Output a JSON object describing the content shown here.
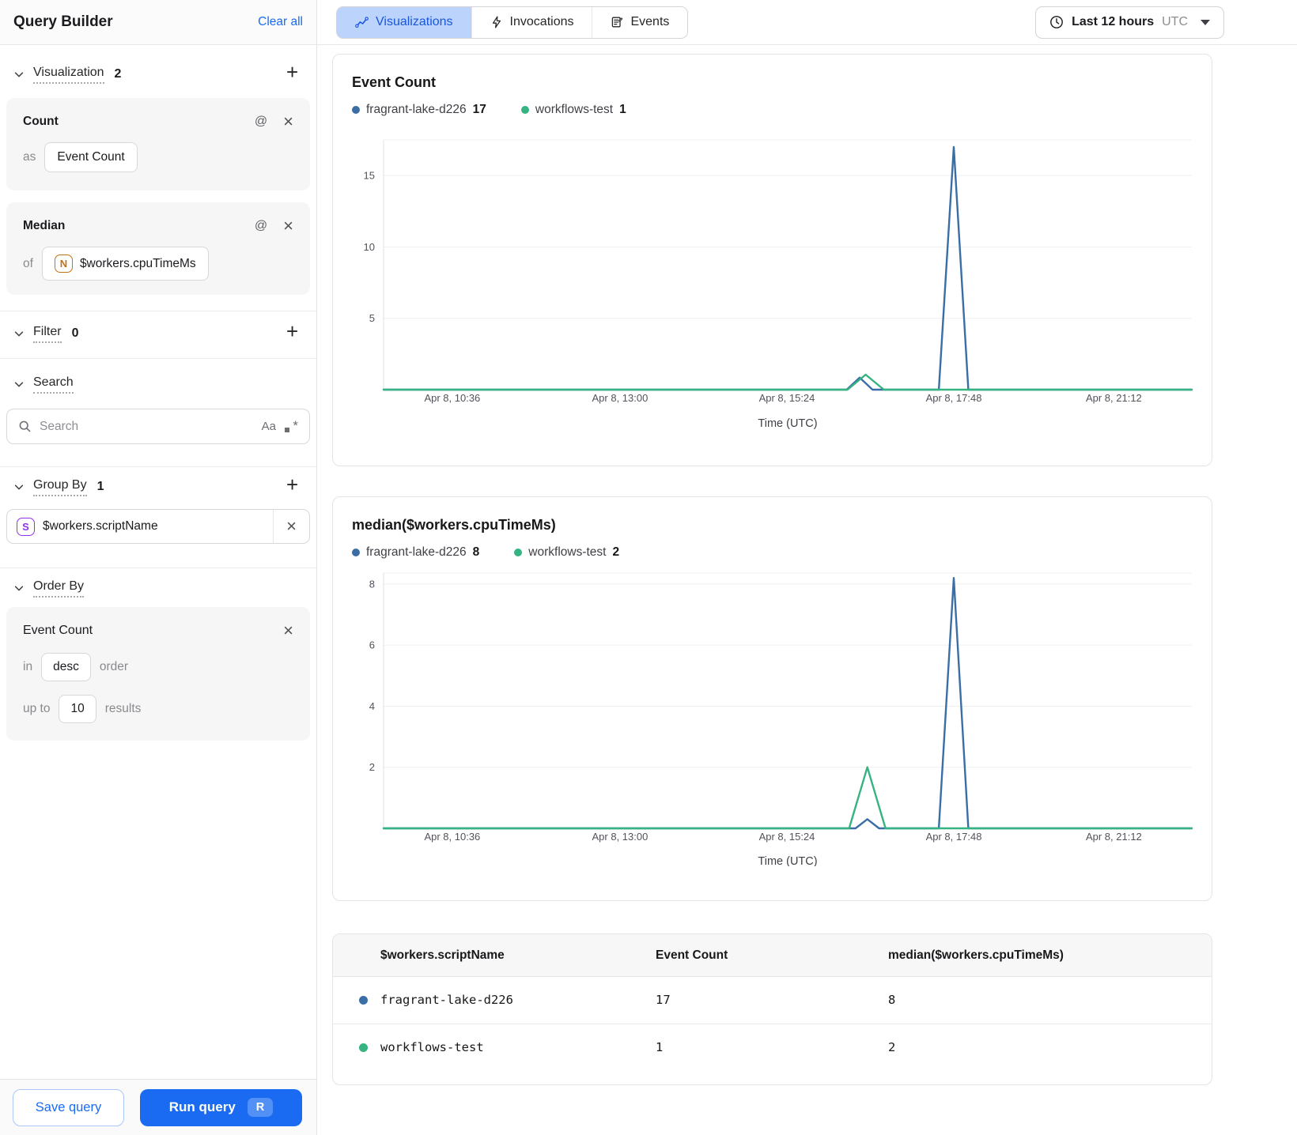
{
  "sidebar": {
    "title": "Query Builder",
    "clear_all": "Clear all",
    "visualization": {
      "label": "Visualization",
      "count": "2",
      "cards": [
        {
          "name": "Count",
          "prefix": "as",
          "value": "Event Count"
        },
        {
          "name": "Median",
          "prefix": "of",
          "badge": "N",
          "value": "$workers.cpuTimeMs"
        }
      ]
    },
    "filter": {
      "label": "Filter",
      "count": "0"
    },
    "search": {
      "label": "Search",
      "placeholder": "Search"
    },
    "group_by": {
      "label": "Group By",
      "count": "1",
      "badge": "S",
      "value": "$workers.scriptName"
    },
    "order_by": {
      "label": "Order By",
      "field": "Event Count",
      "in_label": "in",
      "direction": "desc",
      "order_label": "order",
      "up_to_label": "up to",
      "limit": "10",
      "results_label": "results"
    },
    "save_button": "Save query",
    "run_button": "Run query",
    "run_shortcut": "R"
  },
  "topbar": {
    "tabs": [
      {
        "label": "Visualizations",
        "active": true
      },
      {
        "label": "Invocations",
        "active": false
      },
      {
        "label": "Events",
        "active": false
      }
    ],
    "time_range": {
      "label": "Last 12 hours",
      "timezone": "UTC"
    }
  },
  "icons": {
    "tab_0": "line-chart-icon",
    "tab_1": "lightning-icon",
    "tab_2": "form-icon",
    "time": "clock-icon",
    "search": "magnifier-icon",
    "case": "match-case-icon (Aa)",
    "regex": "regex-icon (.*)",
    "section": "chevron-down-icon",
    "add": "plus-icon",
    "mention": "at-sign-icon",
    "remove": "close-icon"
  },
  "colors": {
    "series_blue": "#3b6ea5",
    "series_green": "#35b380",
    "accent_blue": "#1a6bf2",
    "active_tab_bg": "#bcd3fb",
    "grid": "#efefef",
    "axis": "#e2e2e6"
  },
  "chart_data": [
    {
      "type": "line",
      "title": "Event Count",
      "xlabel": "Time (UTC)",
      "ylim": [
        0,
        17.5
      ],
      "yticks": [
        5,
        10,
        15
      ],
      "grid": true,
      "legend_position": "top",
      "xticks": [
        {
          "pos": 0.085,
          "label": "Apr 8, 10:36"
        },
        {
          "pos": 0.2925,
          "label": "Apr 8, 13:00"
        },
        {
          "pos": 0.499,
          "label": "Apr 8, 15:24"
        },
        {
          "pos": 0.7055,
          "label": "Apr 8, 17:48"
        },
        {
          "pos": 0.9035,
          "label": "Apr 8, 21:12"
        }
      ],
      "series": [
        {
          "name": "fragrant-lake-d226",
          "legend_value": "17",
          "color": "#3b6ea5",
          "points": [
            [
              0,
              0
            ],
            [
              0.573,
              0
            ],
            [
              0.589,
              0.85
            ],
            [
              0.605,
              0
            ],
            [
              0.687,
              0
            ],
            [
              0.7055,
              17
            ],
            [
              0.7235,
              0
            ],
            [
              1,
              0
            ]
          ]
        },
        {
          "name": "workflows-test",
          "legend_value": "1",
          "color": "#35b380",
          "points": [
            [
              0,
              0
            ],
            [
              0.574,
              0
            ],
            [
              0.5965,
              1.05
            ],
            [
              0.619,
              0
            ],
            [
              1,
              0
            ]
          ]
        }
      ]
    },
    {
      "type": "line",
      "title": "median($workers.cpuTimeMs)",
      "xlabel": "Time (UTC)",
      "ylim": [
        0,
        8.36
      ],
      "yticks": [
        2,
        4,
        6,
        8
      ],
      "grid": true,
      "legend_position": "top",
      "xticks": [
        {
          "pos": 0.085,
          "label": "Apr 8, 10:36"
        },
        {
          "pos": 0.2925,
          "label": "Apr 8, 13:00"
        },
        {
          "pos": 0.499,
          "label": "Apr 8, 15:24"
        },
        {
          "pos": 0.7055,
          "label": "Apr 8, 17:48"
        },
        {
          "pos": 0.9035,
          "label": "Apr 8, 21:12"
        }
      ],
      "series": [
        {
          "name": "fragrant-lake-d226",
          "legend_value": "8",
          "color": "#3b6ea5",
          "points": [
            [
              0,
              0
            ],
            [
              0.584,
              0
            ],
            [
              0.5985,
              0.3
            ],
            [
              0.613,
              0
            ],
            [
              0.687,
              0
            ],
            [
              0.7055,
              8.2
            ],
            [
              0.7235,
              0
            ],
            [
              1,
              0
            ]
          ]
        },
        {
          "name": "workflows-test",
          "legend_value": "2",
          "color": "#35b380",
          "points": [
            [
              0,
              0
            ],
            [
              0.576,
              0
            ],
            [
              0.5985,
              2.0
            ],
            [
              0.621,
              0
            ],
            [
              1,
              0
            ]
          ]
        }
      ]
    }
  ],
  "table": {
    "columns": [
      "$workers.scriptName",
      "Event Count",
      "median($workers.cpuTimeMs)"
    ],
    "rows": [
      {
        "dot_color": "#3b6ea5",
        "name": "fragrant-lake-d226",
        "values": [
          "17",
          "8"
        ]
      },
      {
        "dot_color": "#35b380",
        "name": "workflows-test",
        "values": [
          "1",
          "2"
        ]
      }
    ]
  }
}
